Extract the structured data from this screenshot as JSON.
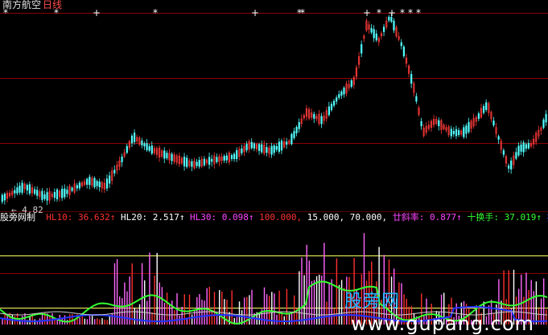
{
  "header": {
    "stock_name": "南方航空",
    "period": "日线"
  },
  "price_panel": {
    "low_marker": "4.82",
    "markers": [
      "*",
      "*",
      "*",
      "*",
      "*",
      "*",
      "*",
      "*",
      "*",
      "*",
      "*",
      "*",
      "*",
      "*",
      "*",
      "*"
    ]
  },
  "indicator_header": {
    "name": "股旁网制",
    "items": [
      {
        "label": "HL10:",
        "value": "36.632",
        "arrow": "↑",
        "color": "#ff3030"
      },
      {
        "label": "HL20:",
        "value": "2.517",
        "arrow": "↑",
        "color": "#ffffff"
      },
      {
        "label": "HL30:",
        "value": "0.098",
        "arrow": "↑",
        "color": "#ff44ff"
      },
      {
        "label": "",
        "value": "100.000,",
        "arrow": "",
        "color": "#ff3030"
      },
      {
        "label": "",
        "value": "15.000,",
        "arrow": "",
        "color": "#ffffff"
      },
      {
        "label": "",
        "value": "70.000,",
        "arrow": "",
        "color": "#ffffff"
      },
      {
        "label": "廿斜率:",
        "value": "0.877",
        "arrow": "↑",
        "color": "#ff44ff"
      },
      {
        "label": "十换手:",
        "value": "37.019",
        "arrow": "↑",
        "color": "#33ff33"
      },
      {
        "label": "按主",
        "value": "",
        "arrow": "",
        "color": "#3355ff"
      }
    ]
  },
  "watermark": {
    "cn": "股旁网",
    "url": "www.gupang.com"
  },
  "colors": {
    "background": "#000000",
    "up_candle": "#ff3b3b",
    "down_candle": "#54ffff",
    "grid": "#8b0000",
    "yellow_line": "#ffff66",
    "green_line": "#33ff33",
    "blue_line": "#2233ff"
  }
}
